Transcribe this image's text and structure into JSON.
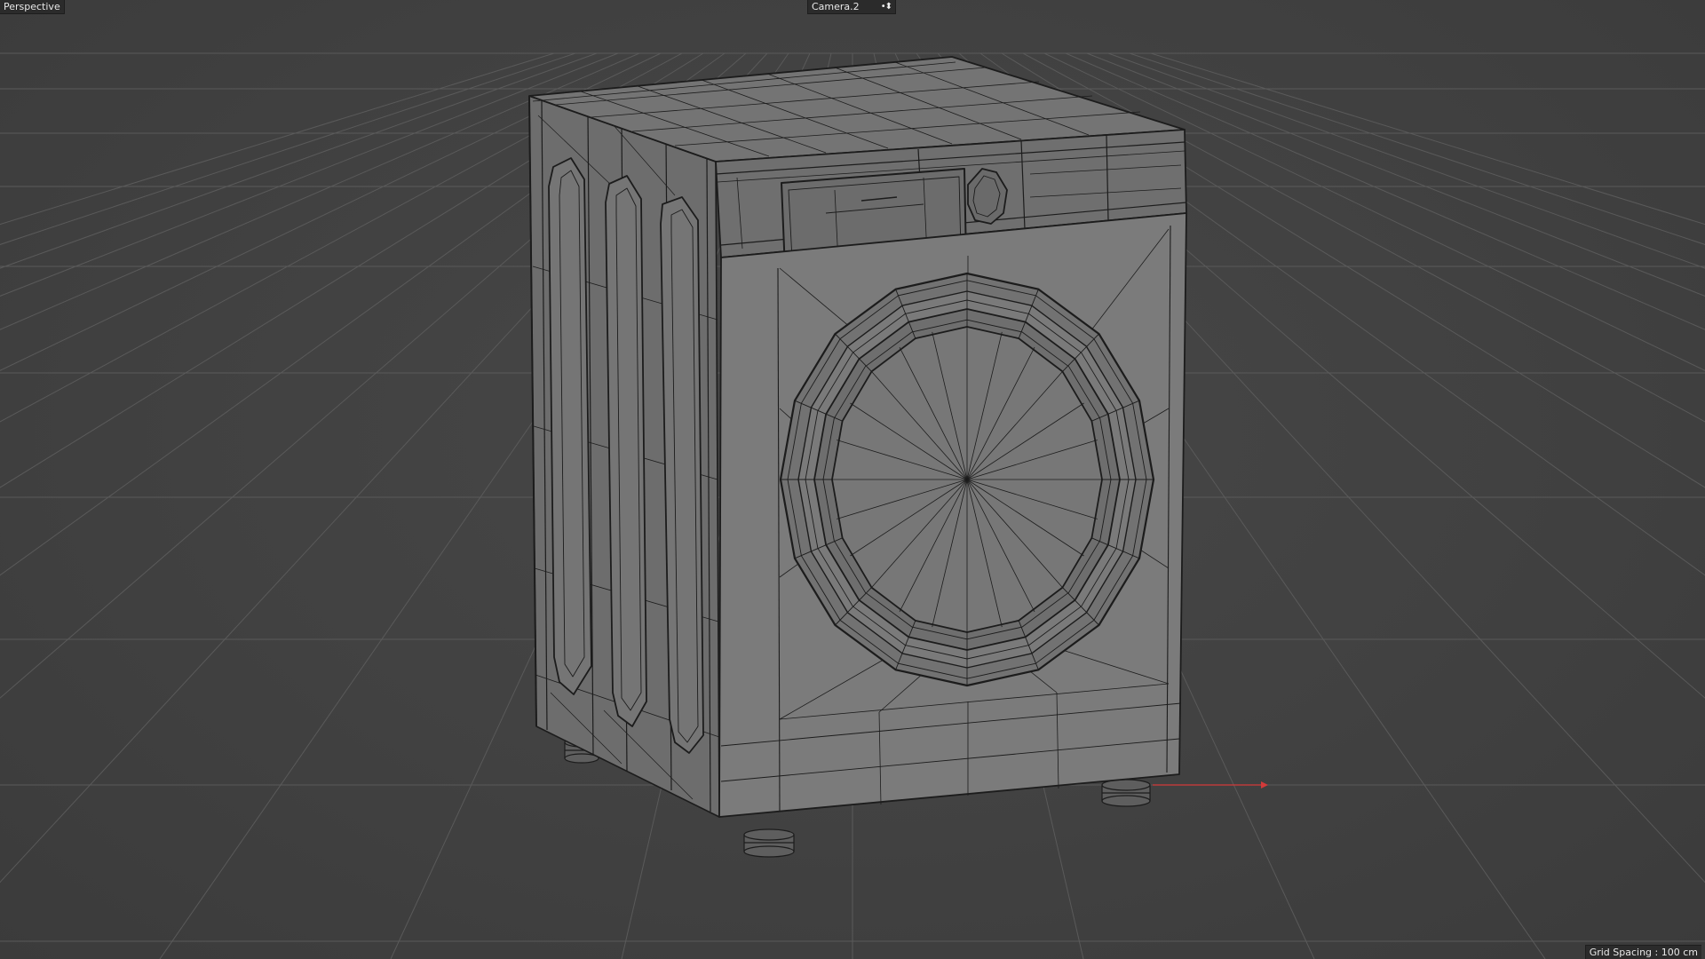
{
  "viewport": {
    "view_mode": "Perspective",
    "camera": {
      "name": "Camera.2",
      "icon": "camera-options-icon"
    },
    "grid_spacing": "Grid Spacing : 100 cm",
    "colors": {
      "background": "#414141",
      "grid_line": "#5a5a5a",
      "model_fill": "#7b7b7b",
      "wire": "#1c1c1c",
      "x_axis": "#d23a3a"
    }
  },
  "scene": {
    "object": "washing-machine",
    "shading": "shaded-wireframe"
  }
}
